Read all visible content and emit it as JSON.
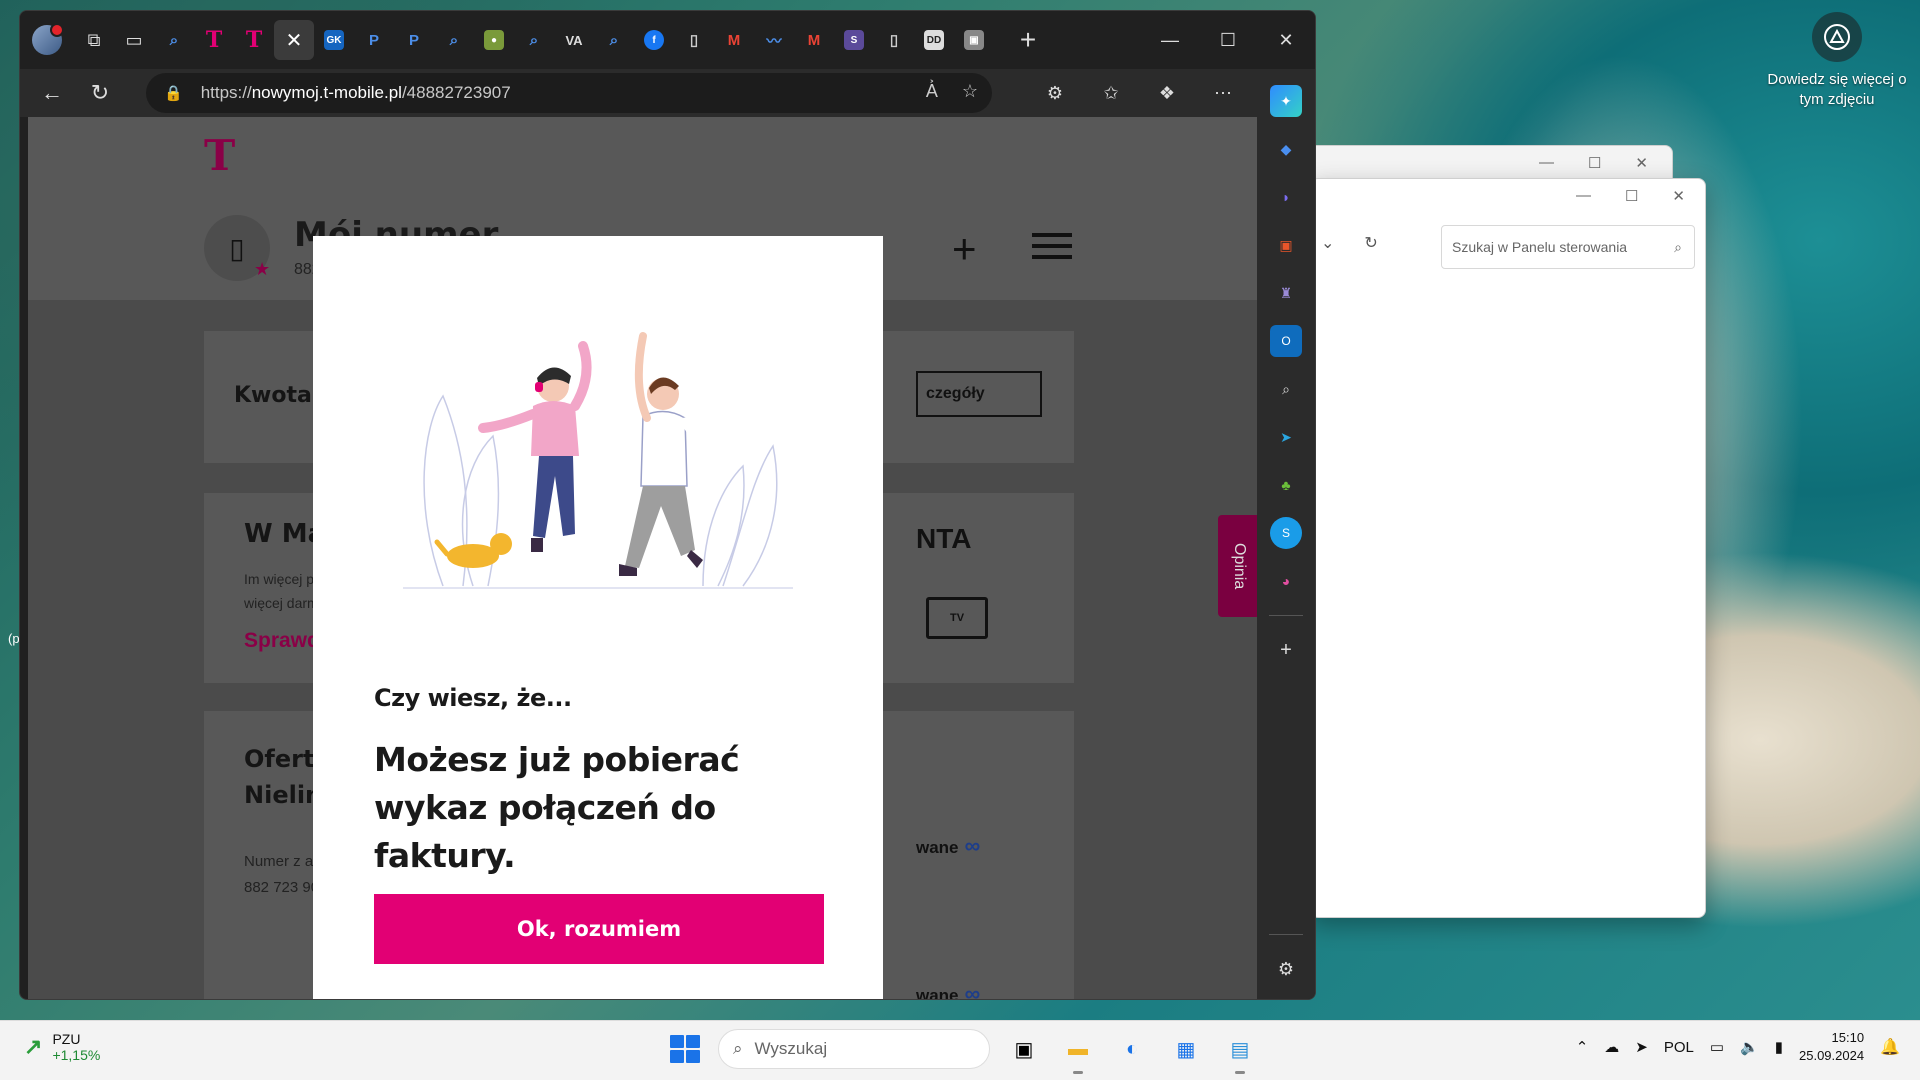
{
  "desktop": {
    "info_text": "Dowiedz się więcej o tym zdjęciu",
    "stub_text": "(p"
  },
  "browser": {
    "tabs": [
      "search",
      "T",
      "T",
      "close",
      "GK",
      "P",
      "P",
      "search",
      "leaf",
      "search",
      "VA",
      "search",
      "f",
      "doc",
      "M",
      "wave",
      "M",
      "S",
      "doc",
      "DD",
      "box"
    ],
    "url_prefix": "https://",
    "url_host": "nowymoj.t-mobile.pl",
    "url_path": "/48882723907"
  },
  "control_panel": {
    "search_placeholder": "Szukaj w Panelu sterowania"
  },
  "site": {
    "header_title": "Mój numer",
    "header_number": "882 723",
    "card1_title": "Kwota do za",
    "card1_button": "czegóły",
    "card2_title": "W Magent",
    "card2_sub_line1": "Im więcej podpis",
    "card2_sub_line2": "więcej darmowy",
    "card2_cta": "Sprawdź!",
    "card2_right_title": "NTA",
    "card2_tv": "TV",
    "card3_title_line1": "Oferta L",
    "card3_title_line2": "Nielimitow",
    "card3_sub_line1": "Numer z abonam",
    "card3_sub_line2": "882 723 907",
    "card3_unlim1": "wane",
    "card3_unlim2": "wane",
    "feedback_tab": "Opinia"
  },
  "modal": {
    "kicker": "Czy wiesz, że...",
    "headline": "Możesz już pobierać wykaz połączeń do faktury.",
    "button_label": "Ok, rozumiem"
  },
  "taskbar": {
    "stock_name": "PZU",
    "stock_change": "+1,15%",
    "search_placeholder": "Wyszukaj",
    "lang": "POL",
    "time": "15:10",
    "date": "25.09.2024"
  },
  "colors": {
    "brand": "#e20074",
    "browser_bg": "#202020"
  }
}
